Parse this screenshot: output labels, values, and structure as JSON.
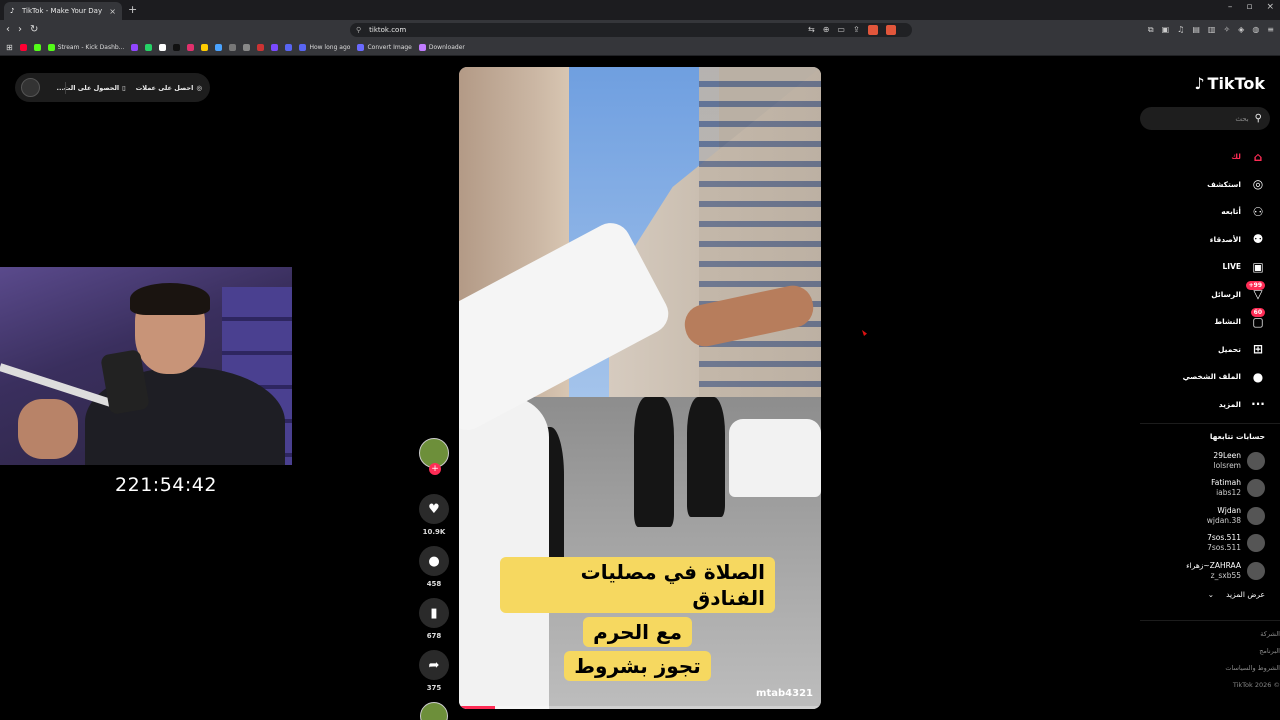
{
  "browser": {
    "tab_title": "TikTok - Make Your Day",
    "tab_close": "×",
    "new_tab": "+",
    "url": "tiktok.com",
    "win_controls": [
      "–",
      "▫",
      "×"
    ],
    "bookmarks": [
      {
        "label": "",
        "color": "#ff0033"
      },
      {
        "label": "",
        "color": "#53fc18"
      },
      {
        "label": "Stream - Kick Dashb...",
        "color": "#53fc18"
      },
      {
        "label": "",
        "color": "#9146ff"
      },
      {
        "label": "",
        "color": "#25d366"
      },
      {
        "label": "",
        "color": "#ffffff"
      },
      {
        "label": "",
        "color": "#111111"
      },
      {
        "label": "",
        "color": "#e1306c"
      },
      {
        "label": "",
        "color": "#ffcc00"
      },
      {
        "label": "",
        "color": "#4aa3ff"
      },
      {
        "label": "",
        "color": "#777777"
      },
      {
        "label": "",
        "color": "#888888"
      },
      {
        "label": "",
        "color": "#cc3333"
      },
      {
        "label": "",
        "color": "#7a4aff"
      },
      {
        "label": "",
        "color": "#5865f2"
      },
      {
        "label": "How long ago",
        "color": "#5865f2"
      },
      {
        "label": "Convert Image",
        "color": "#6a6aff"
      },
      {
        "label": "Downloader",
        "color": "#c07cff"
      }
    ]
  },
  "popover": {
    "item1": "احصل على عملات",
    "item2": "الحصول على الت..."
  },
  "stream": {
    "timer": "221:54:42"
  },
  "video": {
    "caption": [
      "الصلاة في مصليات الفنادق",
      "مع الحرم",
      "تجوز بشروط"
    ],
    "username": "mtab4321",
    "progress": 0.1
  },
  "actions": {
    "likes": "10.9K",
    "comments": "458",
    "saves": "678",
    "shares": "375"
  },
  "sidebar": {
    "logo": "TikTok",
    "search_placeholder": "بحث",
    "nav": [
      {
        "label": "لك",
        "icon": "home-icon",
        "glyph": "⌂",
        "active": true
      },
      {
        "label": "استكشف",
        "icon": "compass-icon",
        "glyph": "◎"
      },
      {
        "label": "أتابعه",
        "icon": "user-plus-icon",
        "glyph": "⚇"
      },
      {
        "label": "الأصدقاء",
        "icon": "friends-icon",
        "glyph": "⚉"
      },
      {
        "label": "LIVE",
        "icon": "live-icon",
        "glyph": "▣"
      },
      {
        "label": "الرسائل",
        "icon": "messages-icon",
        "glyph": "▽",
        "badge": "99+"
      },
      {
        "label": "النشاط",
        "icon": "activity-icon",
        "glyph": "▢",
        "badge": "60"
      },
      {
        "label": "تحميل",
        "icon": "upload-icon",
        "glyph": "⊞"
      },
      {
        "label": "الملف الشخصي",
        "icon": "profile-icon",
        "glyph": "●"
      },
      {
        "label": "المزيد",
        "icon": "more-icon",
        "glyph": "···"
      }
    ],
    "following_title": "حسابات تتابعها",
    "following": [
      {
        "name": "29Leen",
        "handle": "lolsrem"
      },
      {
        "name": "Fatimah",
        "handle": "iabs12"
      },
      {
        "name": "Wjdan",
        "handle": "wjdan.38"
      },
      {
        "name": "7sos.511",
        "handle": "7sos.511"
      },
      {
        "name": "ZAHRAA~زهراء",
        "handle": "z_sxb55"
      }
    ],
    "see_more": "عرض المزيد",
    "footer": [
      "الشركة",
      "البرنامج",
      "الشروط والسياسات",
      "© 2026 TikTok"
    ]
  }
}
